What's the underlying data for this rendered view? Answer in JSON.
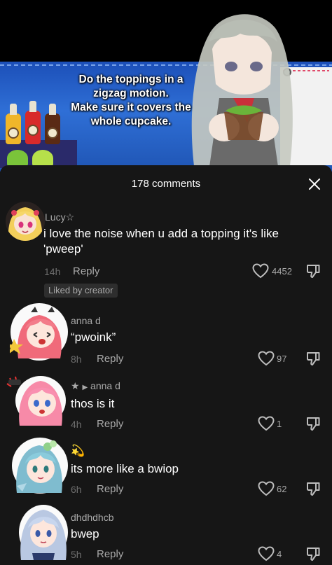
{
  "video": {
    "caption_line1": "Do the toppings in a",
    "caption_line2": "zigzag motion.",
    "caption_line3": "Make sure it covers the",
    "caption_line4": "whole cupcake."
  },
  "header": {
    "title": "178 comments"
  },
  "colors": {
    "background": "#161616",
    "text_primary": "#ffffff",
    "text_secondary": "#a9a9a9",
    "text_muted": "#6e6e6e",
    "badge_bg": "#2e2e2e"
  },
  "comments": [
    {
      "username": "Lucy☆",
      "text_line1": "i love the noise when u add a topping it's like",
      "text_line2": "'pweep'",
      "time": "14h",
      "reply_label": "Reply",
      "likes": "4452",
      "badge": "Liked by creator"
    },
    {
      "username": "anna d",
      "text": "“pwoink”",
      "time": "8h",
      "reply_label": "Reply",
      "likes": "97"
    },
    {
      "username_prefix": "★",
      "reply_to": "anna d",
      "text": "thos is it",
      "time": "4h",
      "reply_label": "Reply",
      "likes": "1"
    },
    {
      "username": "💫",
      "text": "its more like a bwiop",
      "time": "6h",
      "reply_label": "Reply",
      "likes": "62"
    },
    {
      "username": "dhdhdhcb",
      "text": "bwep",
      "time": "5h",
      "reply_label": "Reply",
      "likes": "4"
    }
  ],
  "icons": {
    "close": "close-icon",
    "like": "heart-icon",
    "dislike": "thumbs-down-icon",
    "reply_arrow": "caret-right-icon"
  }
}
